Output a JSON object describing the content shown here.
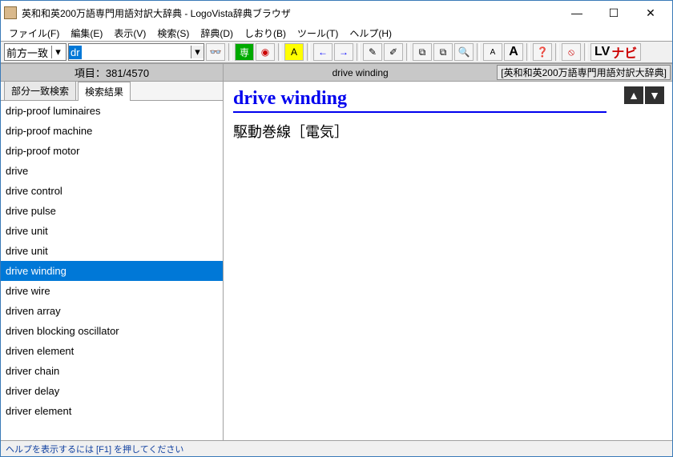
{
  "window": {
    "title": "英和和英200万語専門用語対訳大辞典 - LogoVista辞典ブラウザ",
    "min": "—",
    "max": "☐",
    "close": "✕"
  },
  "menu": {
    "file": "ファイル(F)",
    "edit": "編集(E)",
    "view": "表示(V)",
    "search": "検索(S)",
    "dict": "辞典(D)",
    "bookmark": "しおり(B)",
    "tool": "ツール(T)",
    "help": "ヘルプ(H)"
  },
  "toolbar": {
    "match_mode": "前方一致",
    "query": "dr",
    "binoc": "🔍",
    "book_green": "専",
    "globe": "◉",
    "hl": "A",
    "back": "←",
    "fwd": "→",
    "pen1": "✎",
    "pen2": "✐",
    "copy1": "⧉",
    "copy2": "⧉",
    "zoom": "🔍",
    "font_small": "A",
    "font_large": "A",
    "help": "❓",
    "stop": "⦸",
    "lv": "LV",
    "nav": "ナビ"
  },
  "left": {
    "count_label": "項目：381/4570",
    "tab_partial": "部分一致検索",
    "tab_results": "検索結果",
    "items": [
      "drip-proof luminaires",
      "drip-proof machine",
      "drip-proof motor",
      "drive",
      "drive control",
      "drive pulse",
      "drive unit",
      "drive unit",
      "drive winding",
      "drive wire",
      "driven array",
      "driven blocking oscillator",
      "driven element",
      "driver chain",
      "driver delay",
      "driver element"
    ],
    "selected_index": 8
  },
  "right": {
    "current": "drive winding",
    "dict_label": "[英和和英200万語専門用語対訳大辞典]",
    "headword": "drive winding",
    "definition": "駆動巻線［電気］",
    "up": "▲",
    "down": "▼"
  },
  "status": "ヘルプを表示するには [F1] を押してください"
}
